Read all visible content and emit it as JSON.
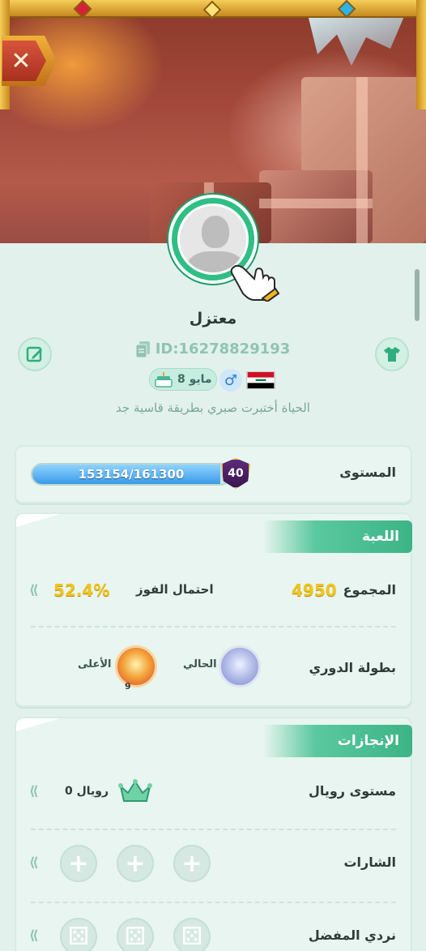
{
  "profile": {
    "username": "معتزل",
    "id_text": "ID:16278829193",
    "birthday": "8 مايو",
    "gender_symbol": "♂",
    "bio": "الحياة أختبرت صبري بطريقة قاسية جد"
  },
  "icons": {
    "close": "close-icon",
    "edit": "edit-icon",
    "shirt": "shirt-icon",
    "copy": "copy-icon",
    "cake": "cake-icon",
    "flag": "iraq-flag-icon",
    "chevron": "double-chevron-left-icon"
  },
  "level": {
    "label": "المستوى",
    "progress_text": "153154/161300",
    "progress_fraction": 0.9495,
    "level_number": "40"
  },
  "game": {
    "section_title": "اللعبة",
    "total_label": "المجموع",
    "total_value": "4950",
    "win_rate_label": "احتمال الفوز",
    "win_rate_value": "52.4%",
    "league_label": "بطولة الدوري",
    "current_label": "الحالي",
    "highest_label": "الأعلى",
    "highest_count": "9"
  },
  "achievements": {
    "section_title": "الإنجازات",
    "royal_label": "مستوى رويال",
    "royal_value": "رويال 0",
    "badges_label": "الشارات",
    "dice_label": "نردي المفضل"
  },
  "colors": {
    "accent_green": "#3cb486",
    "gold": "#f1c51e",
    "background": "#e3f1ec",
    "progress_blue": "#3a9be8"
  }
}
